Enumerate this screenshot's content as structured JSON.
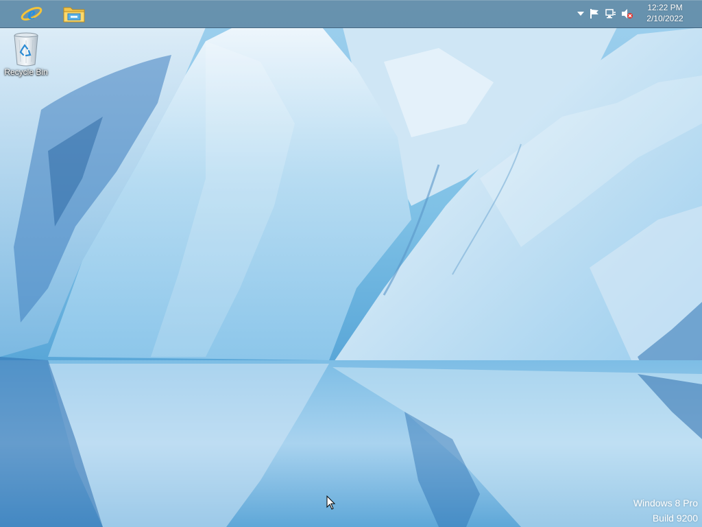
{
  "taskbar": {
    "pinned": [
      {
        "name": "internet-explorer-icon"
      },
      {
        "name": "file-explorer-icon"
      }
    ],
    "tray": {
      "icons": [
        "show-hidden-icons-arrow-icon",
        "action-center-flag-icon",
        "network-icon",
        "volume-muted-icon"
      ],
      "time": "12:22 PM",
      "date": "2/10/2022"
    }
  },
  "desktop": {
    "icons": [
      {
        "label": "Recycle Bin",
        "icon": "recycle-bin-icon"
      }
    ]
  },
  "watermark": {
    "line1": "Windows 8 Pro",
    "line2": "Build 9200"
  },
  "colors": {
    "taskbar": "#5c84a0",
    "ice_light": "#e8f3fb",
    "ice_mid": "#9fd0ee",
    "ice_dark": "#2e6fb0"
  }
}
